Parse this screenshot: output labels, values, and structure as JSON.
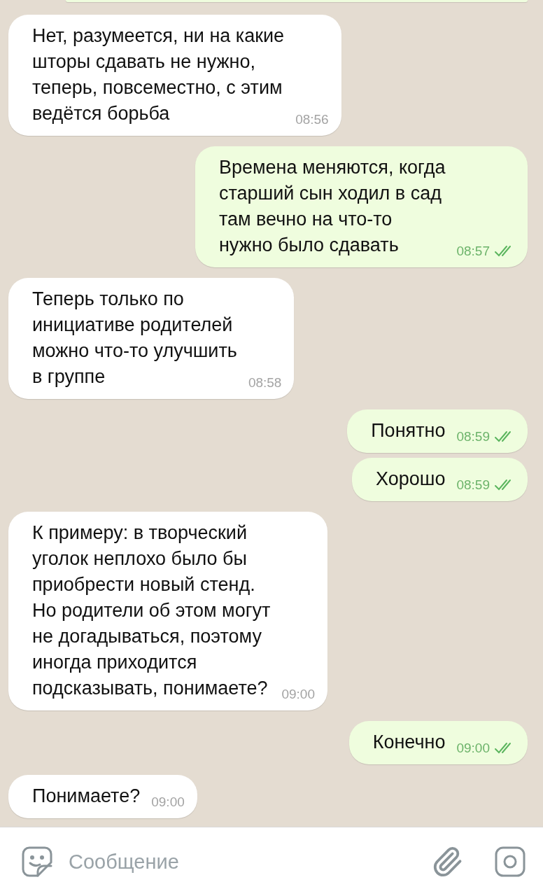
{
  "messages": [
    {
      "kind": "incoming",
      "text": "Нет, разумеется, ни на какие\nшторы сдавать не нужно,\nтеперь, повсеместно, с этим\nведётся борьба",
      "time": "08:56"
    },
    {
      "kind": "outgoing",
      "text": "Времена меняются, когда\nстарший сын ходил в сад\nтам вечно на что-то\nнужно было сдавать",
      "time": "08:57",
      "read": true
    },
    {
      "kind": "incoming",
      "text": "Теперь только по\nинициативе родителей\nможно что-то улучшить\nв группе",
      "time": "08:58"
    },
    {
      "kind": "outgoing",
      "text": "Понятно",
      "time": "08:59",
      "read": true
    },
    {
      "kind": "outgoing",
      "text": "Хорошо",
      "time": "08:59",
      "read": true
    },
    {
      "kind": "incoming",
      "text": "К примеру: в творческий\nуголок неплохо было бы\nприобрести новый стенд.\nНо родители об этом могут\nне догадываться, поэтому\nиногда приходится\nподсказывать, понимаете?",
      "time": "09:00"
    },
    {
      "kind": "outgoing",
      "text": "Конечно",
      "time": "09:00",
      "read": true
    },
    {
      "kind": "incoming",
      "text": "Понимаете?",
      "time": "09:00"
    }
  ],
  "composer": {
    "placeholder": "Сообщение"
  }
}
